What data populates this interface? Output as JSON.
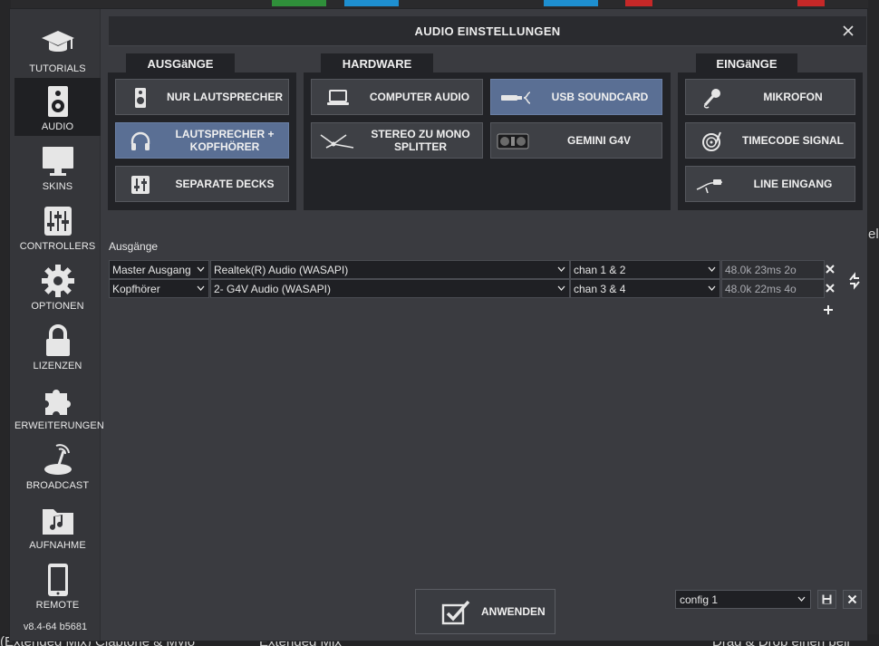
{
  "colors": {
    "accent": "#5a6f94",
    "dialog_bg": "#3a3b40",
    "panel_bg": "#222327"
  },
  "dialog": {
    "title": "AUDIO EINSTELLUNGEN"
  },
  "sidebar": {
    "items": [
      {
        "label": "TUTORIALS",
        "icon": "graduation-cap-icon",
        "active": false
      },
      {
        "label": "AUDIO",
        "icon": "speaker-icon",
        "active": true
      },
      {
        "label": "SKINS",
        "icon": "monitor-icon",
        "active": false
      },
      {
        "label": "CONTROLLERS",
        "icon": "mixer-sliders-icon",
        "active": false
      },
      {
        "label": "OPTIONEN",
        "icon": "gear-icon",
        "active": false
      },
      {
        "label": "LIZENZEN",
        "icon": "lock-icon",
        "active": false
      },
      {
        "label": "ERWEITERUNGEN",
        "icon": "puzzle-icon",
        "active": false
      },
      {
        "label": "BROADCAST",
        "icon": "satellite-dish-icon",
        "active": false
      },
      {
        "label": "AUFNAHME",
        "icon": "music-folder-icon",
        "active": false
      },
      {
        "label": "REMOTE",
        "icon": "tablet-icon",
        "active": false
      }
    ],
    "version": "v8.4-64 b5681"
  },
  "outputs_panel": {
    "tab": "AUSGäNGE",
    "buttons": [
      {
        "label": "NUR LAUTSPRECHER",
        "icon": "speaker-icon",
        "selected": false
      },
      {
        "label": "LAUTSPRECHER + KOPFHÖRER",
        "icon": "headphones-icon",
        "selected": true
      },
      {
        "label": "SEPARATE DECKS",
        "icon": "decks-icon",
        "selected": false
      }
    ]
  },
  "hardware_panel": {
    "tab": "HARDWARE",
    "buttons": [
      {
        "label": "COMPUTER AUDIO",
        "icon": "laptop-icon",
        "selected": false
      },
      {
        "label": "USB SOUNDCARD",
        "icon": "usb-soundcard-icon",
        "selected": true
      },
      {
        "label": "STEREO ZU MONO SPLITTER",
        "icon": "splitter-cable-icon",
        "selected": false
      },
      {
        "label": "GEMINI G4V",
        "icon": "controller-icon",
        "selected": false
      }
    ]
  },
  "inputs_panel": {
    "tab": "EINGäNGE",
    "buttons": [
      {
        "label": "MIKROFON",
        "icon": "microphone-icon",
        "selected": false
      },
      {
        "label": "TIMECODE SIGNAL",
        "icon": "vinyl-icon",
        "selected": false
      },
      {
        "label": "LINE EINGANG",
        "icon": "line-cable-icon",
        "selected": false
      }
    ]
  },
  "outputs_section": {
    "label": "Ausgänge",
    "rows": [
      {
        "channel": "Master Ausgang",
        "device": "Realtek(R) Audio (WASAPI)",
        "chan": "chan 1 & 2",
        "info": "48.0k 23ms 2o"
      },
      {
        "channel": "Kopfhörer",
        "device": "2- G4V Audio (WASAPI)",
        "chan": "chan 3 & 4",
        "info": "48.0k 22ms 4o"
      }
    ]
  },
  "footer": {
    "apply_label": "ANWENDEN",
    "config_value": "config 1"
  },
  "background": {
    "fragments": [
      "(Extended Mix) Claptone & Mylo",
      "Extended Mix",
      "Drag & Drop einen beli",
      "el"
    ]
  }
}
